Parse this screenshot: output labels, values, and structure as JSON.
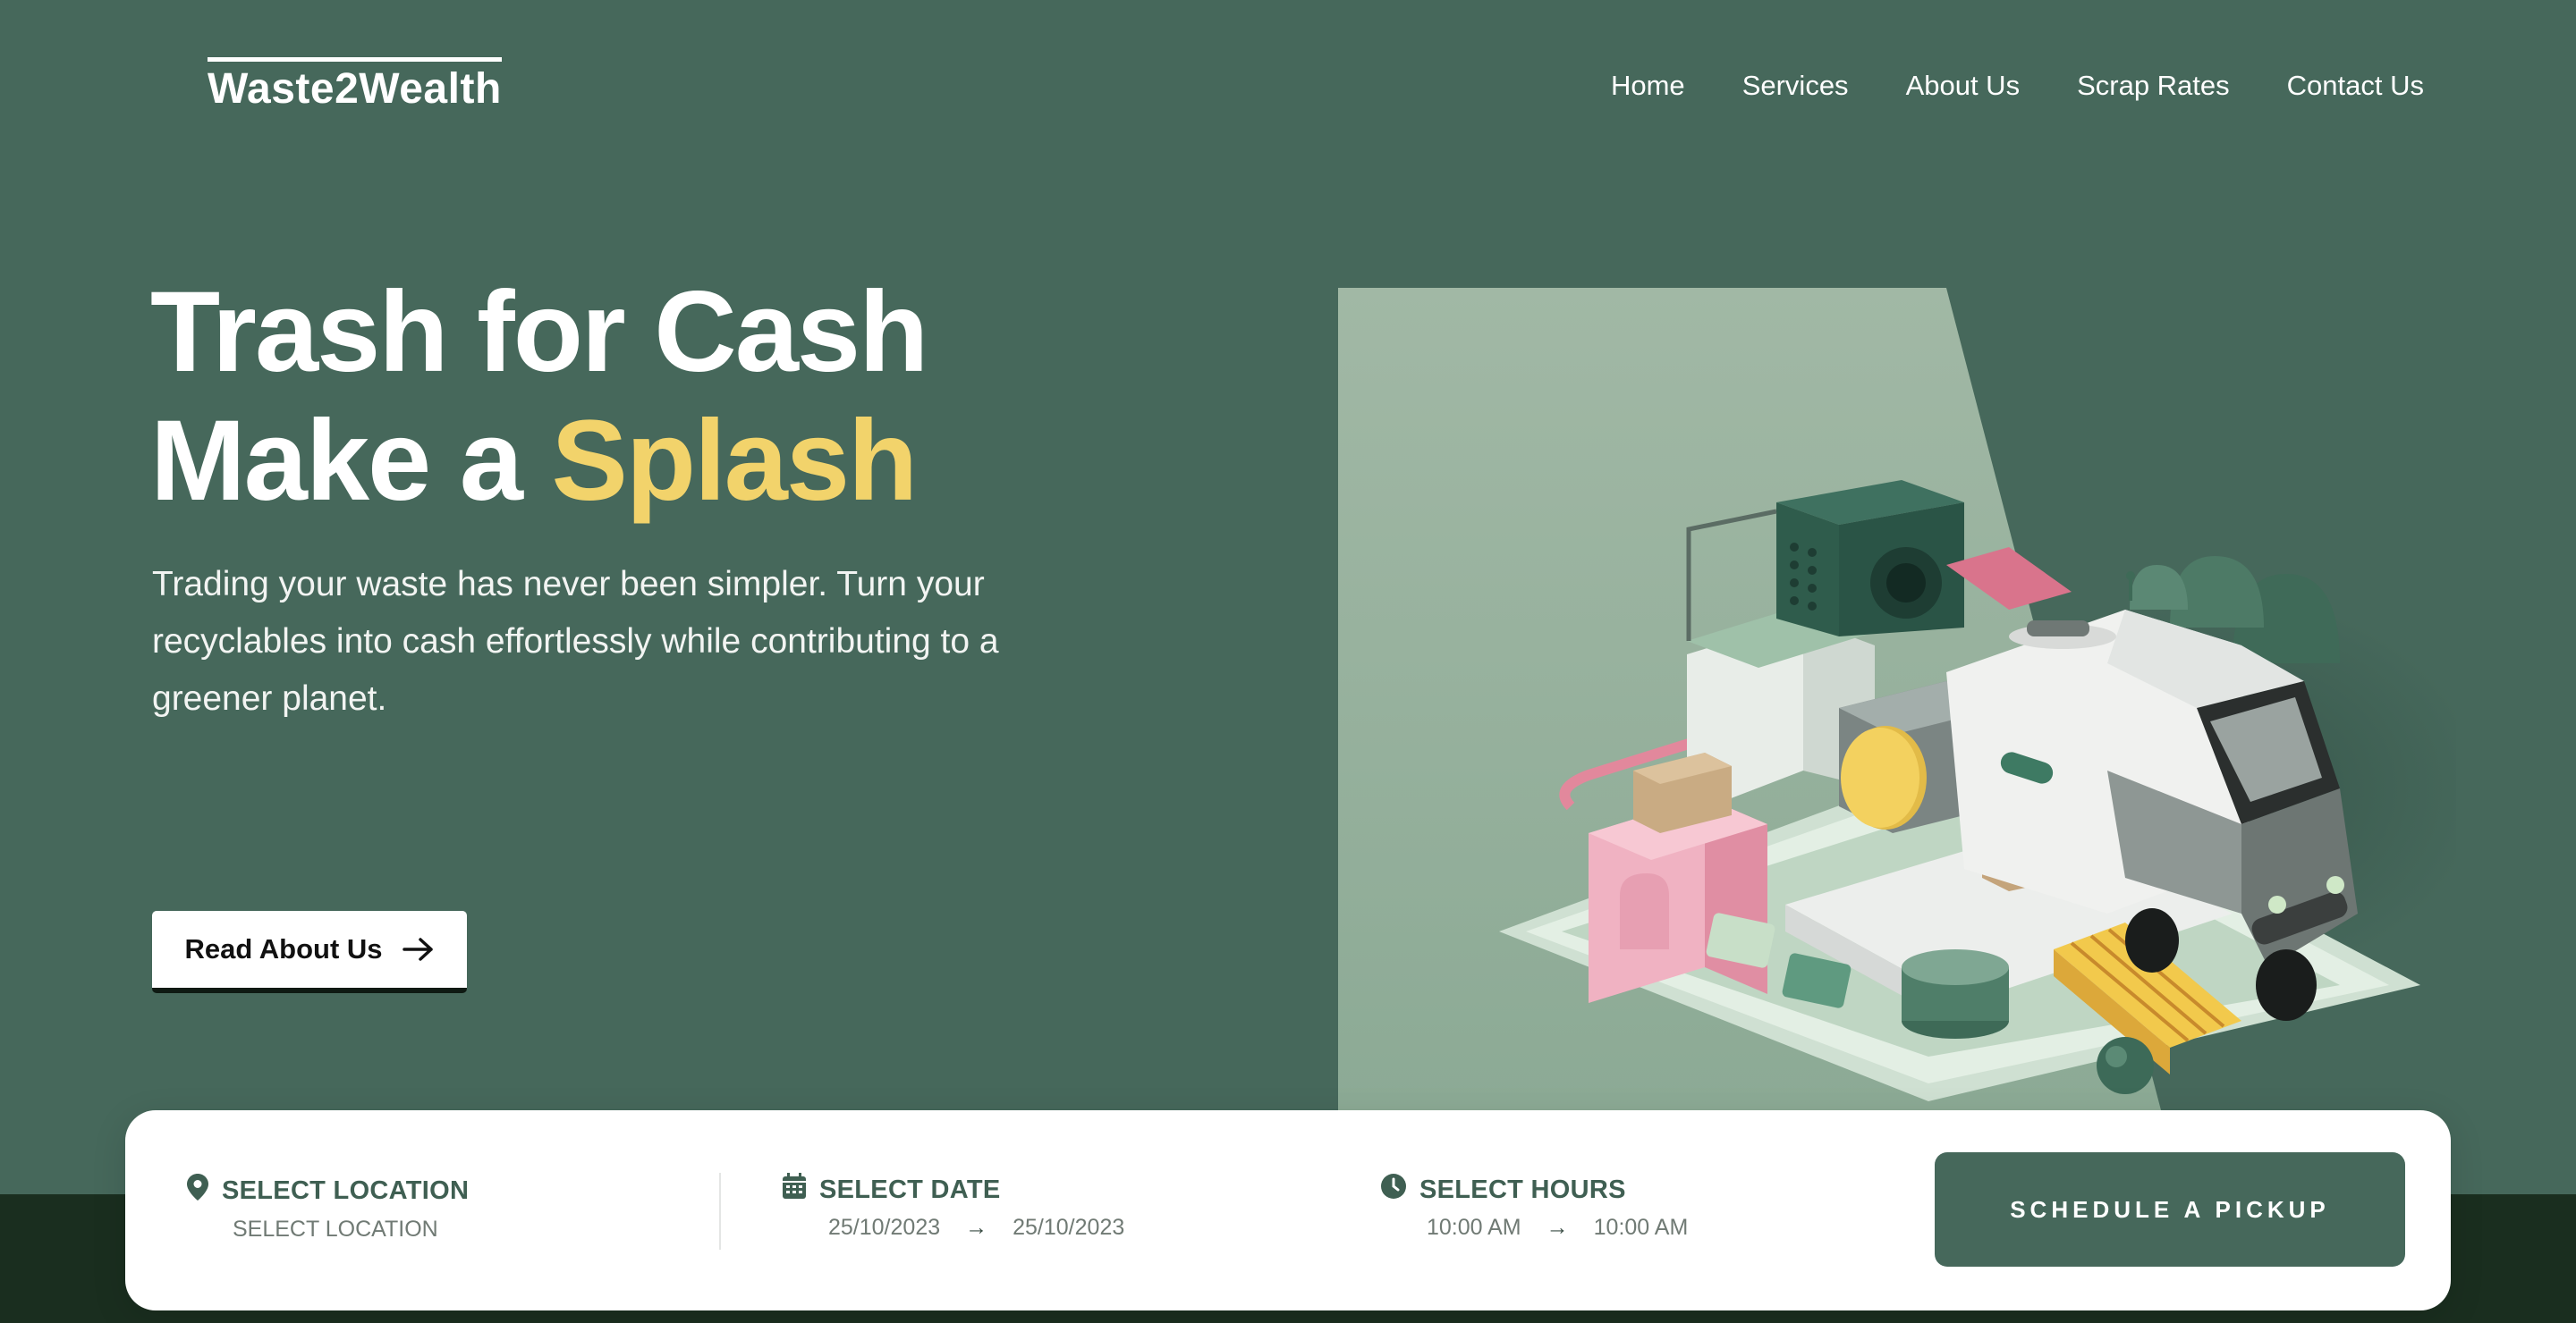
{
  "brand": {
    "logo": "Waste2Wealth"
  },
  "nav": {
    "items": [
      {
        "label": "Home"
      },
      {
        "label": "Services"
      },
      {
        "label": "About Us"
      },
      {
        "label": "Scrap Rates"
      },
      {
        "label": "Contact Us"
      }
    ]
  },
  "hero": {
    "title_line1": "Trash for Cash",
    "title_line2_prefix": "Make a ",
    "title_line2_accent": "Splash",
    "description": "Trading your waste has never been simpler. Turn your recyclables into cash effortlessly while contributing to a greener planet.",
    "cta_label": "Read About Us"
  },
  "booking": {
    "location": {
      "label": "SELECT LOCATION",
      "value": "SELECT LOCATION"
    },
    "date": {
      "label": "SELECT DATE",
      "from": "25/10/2023",
      "to": "25/10/2023"
    },
    "hours": {
      "label": "SELECT HOURS",
      "from": "10:00 AM",
      "to": "10:00 AM"
    },
    "arrow": "→",
    "button_label": "SCHEDULE A PICKUP"
  },
  "colors": {
    "background": "#46685b",
    "accent_yellow": "#f2d36b",
    "card": "#ffffff",
    "label_green": "#3f5f52"
  },
  "icons": {
    "cta": "arrow-right-icon",
    "location": "map-pin-icon",
    "date": "calendar-icon",
    "hours": "clock-icon"
  }
}
